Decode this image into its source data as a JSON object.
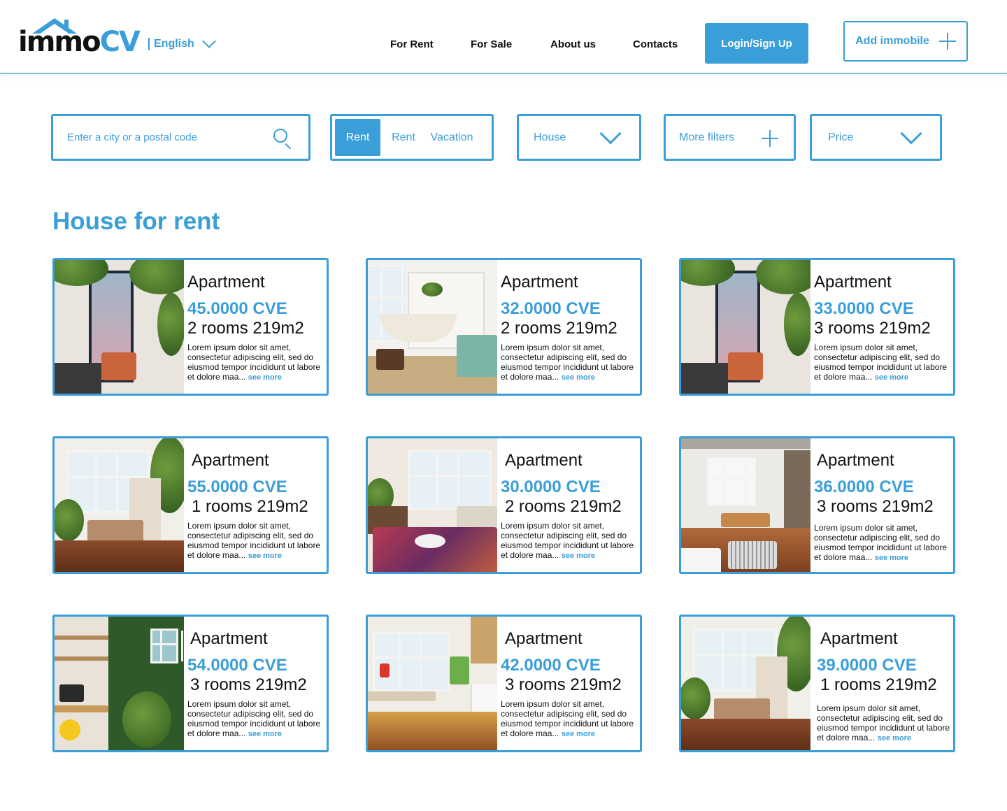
{
  "header": {
    "logo_text_a": "immo",
    "logo_text_b": "CV",
    "language": "English",
    "nav": [
      "For Rent",
      "For Sale",
      "About us",
      "Contacts"
    ],
    "login_label": "Login/Sign Up",
    "add_label": "Add immobile"
  },
  "filters": {
    "search_placeholder": "Enter a city or a postal code",
    "segments": [
      "Rent",
      "Rent",
      "Vacation"
    ],
    "type_value": "House",
    "more_filters": "More filters",
    "price_value": "Price"
  },
  "section_title": "House for rent",
  "listings": [
    {
      "type": "Apartment",
      "price": "45.0000 CVE",
      "rooms": "2 rooms 219m2",
      "desc": "Lorem ipsum dolor sit amet, consectetur adipiscing elit, sed do eiusmod tempor incididunt ut labore et dolore maa...",
      "more": "see more"
    },
    {
      "type": "Apartment",
      "price": "32.0000 CVE",
      "rooms": "2 rooms 219m2",
      "desc": "Lorem ipsum dolor sit amet, consectetur adipiscing elit, sed do eiusmod tempor incididunt ut labore et dolore maa...",
      "more": "see more"
    },
    {
      "type": "Apartment",
      "price": "33.0000 CVE",
      "rooms": "3 rooms 219m2",
      "desc": "Lorem ipsum dolor sit amet, consectetur adipiscing elit, sed do eiusmod tempor incididunt ut labore et dolore maa...",
      "more": "see more"
    },
    {
      "type": "Apartment",
      "price": "55.0000 CVE",
      "rooms": "1 rooms 219m2",
      "desc": "Lorem ipsum dolor sit amet, consectetur adipiscing elit, sed do eiusmod tempor incididunt ut labore et dolore maa...",
      "more": "see more"
    },
    {
      "type": "Apartment",
      "price": "30.0000 CVE",
      "rooms": "2 rooms 219m2",
      "desc": "Lorem ipsum dolor sit amet, consectetur adipiscing elit, sed do eiusmod tempor incididunt ut labore et dolore maa...",
      "more": "see more"
    },
    {
      "type": "Apartment",
      "price": "36.0000 CVE",
      "rooms": "3 rooms 219m2",
      "desc": "Lorem ipsum dolor sit amet, consectetur adipiscing elit, sed do eiusmod tempor incididunt ut labore et dolore maa...",
      "more": "see more"
    },
    {
      "type": "Apartment",
      "price": "54.0000 CVE",
      "rooms": "3 rooms 219m2",
      "desc": "Lorem ipsum dolor sit amet, consectetur adipiscing elit, sed do eiusmod tempor incididunt ut labore et dolore maa...",
      "more": "see more"
    },
    {
      "type": "Apartment",
      "price": "42.0000 CVE",
      "rooms": "3 rooms 219m2",
      "desc": "Lorem ipsum dolor sit amet, consectetur adipiscing elit, sed do eiusmod tempor incididunt ut labore et dolore maa...",
      "more": "see more"
    },
    {
      "type": "Apartment",
      "price": "39.0000 CVE",
      "rooms": "1 rooms 219m2",
      "desc": "Lorem ipsum dolor sit amet, consectetur adipiscing elit, sed do eiusmod tempor incididunt ut labore et dolore maa...",
      "more": "see more"
    }
  ],
  "colors": {
    "accent": "#3a9ed8",
    "text": "#111111",
    "background": "#ffffff"
  }
}
